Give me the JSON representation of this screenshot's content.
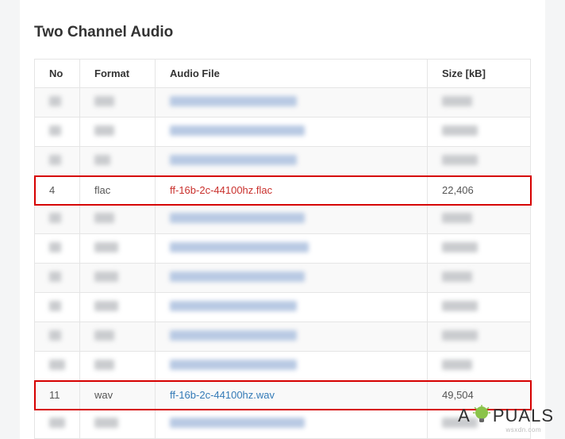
{
  "title": "Two Channel Audio",
  "headers": {
    "no": "No",
    "format": "Format",
    "file": "Audio File",
    "size": "Size [kB]"
  },
  "rows": {
    "flac": {
      "no": "4",
      "format": "flac",
      "file": "ff-16b-2c-44100hz.flac",
      "size": "22,406"
    },
    "wav": {
      "no": "11",
      "format": "wav",
      "file": "ff-16b-2c-44100hz.wav",
      "size": "49,504"
    }
  },
  "watermark": {
    "brand_left": "A",
    "brand_right": "PUALS",
    "domain": "wsxdn.com"
  }
}
